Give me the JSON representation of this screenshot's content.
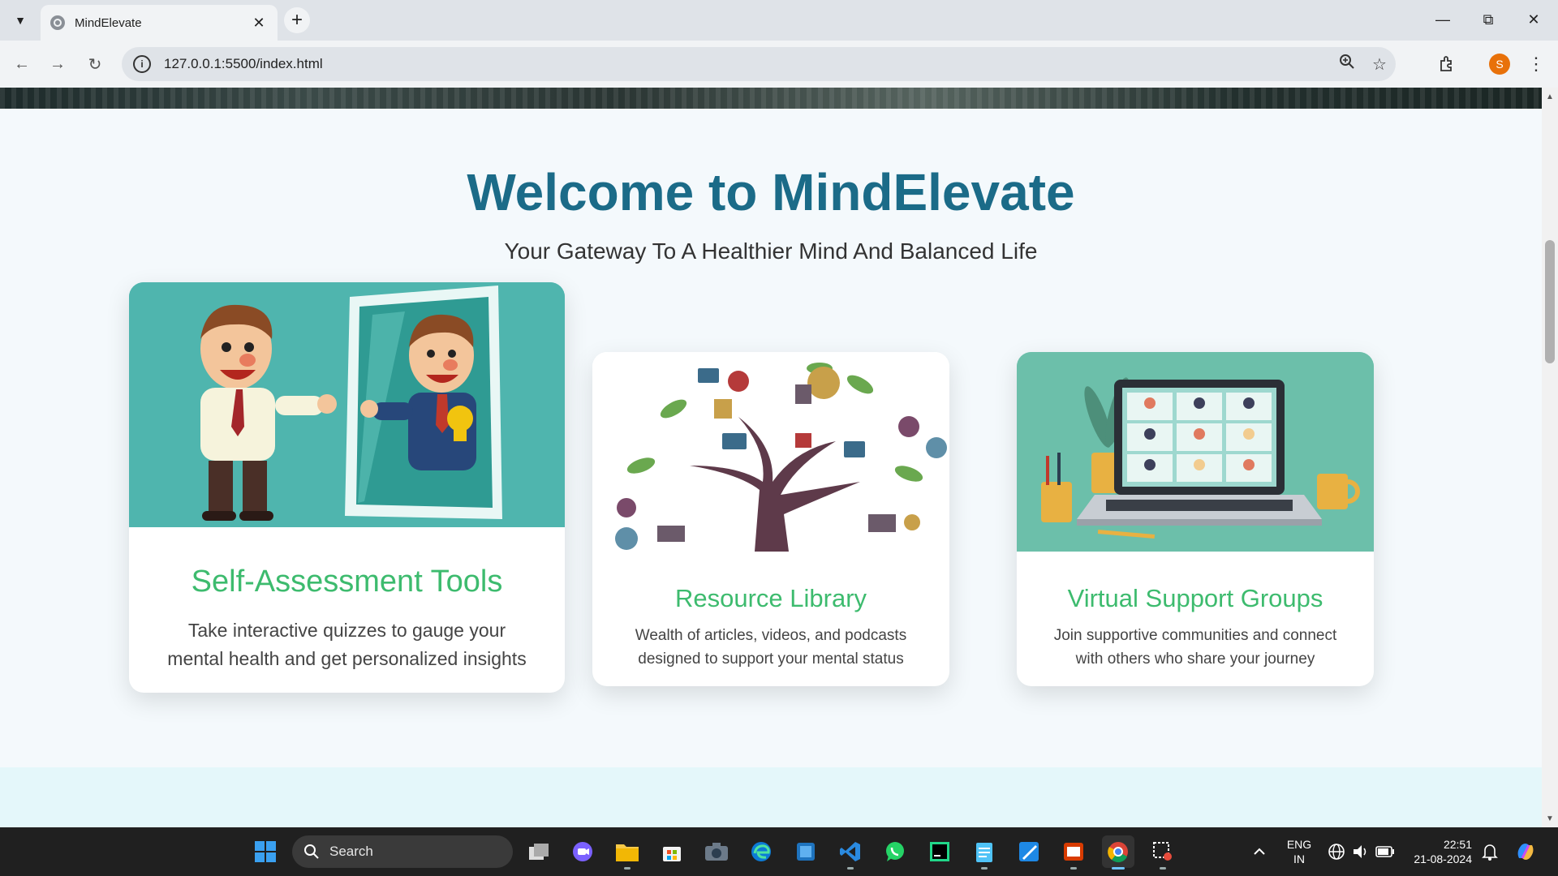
{
  "browser": {
    "tab_title": "MindElevate",
    "url": "127.0.0.1:5500/index.html",
    "profile_initial": "S"
  },
  "page": {
    "welcome_title": "Welcome to MindElevate",
    "welcome_subtitle": "Your Gateway To A Healthier Mind And Balanced Life",
    "cards": [
      {
        "title": "Self-Assessment Tools",
        "description": "Take interactive quizzes to gauge your mental health and get personalized insights"
      },
      {
        "title": "Resource Library",
        "description": "Wealth of articles, videos, and podcasts designed to support your mental status"
      },
      {
        "title": "Virtual Support Groups",
        "description": "Join supportive communities and connect with others who share your journey"
      }
    ],
    "colors": {
      "title": "#1b6b88",
      "card_title": "#3dbb6e",
      "teal": "#4fb5ae"
    }
  },
  "taskbar": {
    "search_placeholder": "Search",
    "language_line1": "ENG",
    "language_line2": "IN",
    "time": "22:51",
    "date": "21-08-2024",
    "apps": [
      "start-icon",
      "task-view-icon",
      "teams-icon",
      "file-explorer-icon",
      "store-icon",
      "camera-icon",
      "edge-icon",
      "app-icon",
      "vscode-icon",
      "whatsapp-icon",
      "pycharm-icon",
      "notepad-icon",
      "paint-icon",
      "office-icon",
      "chrome-icon",
      "snipping-icon"
    ]
  }
}
